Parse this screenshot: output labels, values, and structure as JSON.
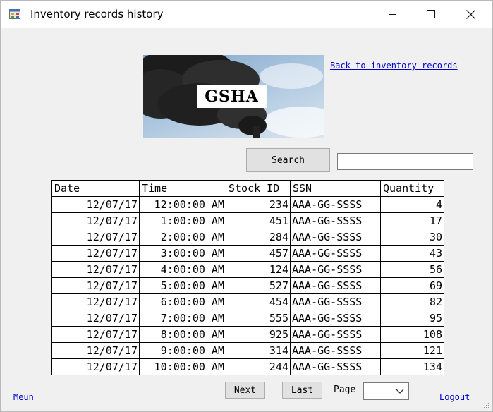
{
  "window": {
    "title": "Inventory records history"
  },
  "banner": {
    "logo_text": "GSHA"
  },
  "nav": {
    "back_link": "Back to inventory records",
    "menu_link": "Meun",
    "logout_link": "Logout"
  },
  "search": {
    "button_label": "Search",
    "value": ""
  },
  "table": {
    "columns": [
      "Date",
      "Time",
      "Stock ID",
      "SSN",
      "Quantity"
    ],
    "rows": [
      [
        "12/07/17",
        "12:00:00 AM",
        "234",
        "AAA-GG-SSSS",
        "4"
      ],
      [
        "12/07/17",
        "1:00:00 AM",
        "451",
        "AAA-GG-SSSS",
        "17"
      ],
      [
        "12/07/17",
        "2:00:00 AM",
        "284",
        "AAA-GG-SSSS",
        "30"
      ],
      [
        "12/07/17",
        "3:00:00 AM",
        "457",
        "AAA-GG-SSSS",
        "43"
      ],
      [
        "12/07/17",
        "4:00:00 AM",
        "124",
        "AAA-GG-SSSS",
        "56"
      ],
      [
        "12/07/17",
        "5:00:00 AM",
        "527",
        "AAA-GG-SSSS",
        "69"
      ],
      [
        "12/07/17",
        "6:00:00 AM",
        "454",
        "AAA-GG-SSSS",
        "82"
      ],
      [
        "12/07/17",
        "7:00:00 AM",
        "555",
        "AAA-GG-SSSS",
        "95"
      ],
      [
        "12/07/17",
        "8:00:00 AM",
        "925",
        "AAA-GG-SSSS",
        "108"
      ],
      [
        "12/07/17",
        "9:00:00 AM",
        "314",
        "AAA-GG-SSSS",
        "121"
      ],
      [
        "12/07/17",
        "10:00:00 AM",
        "244",
        "AAA-GG-SSSS",
        "134"
      ]
    ]
  },
  "pager": {
    "next_label": "Next",
    "last_label": "Last",
    "page_label": "Page",
    "page_value": ""
  },
  "icons": {
    "app": "app-window-icon",
    "minimize": "minimize-icon",
    "maximize": "maximize-icon",
    "close": "close-icon",
    "dropdown": "chevron-down-icon",
    "grip": "resize-grip-icon"
  }
}
